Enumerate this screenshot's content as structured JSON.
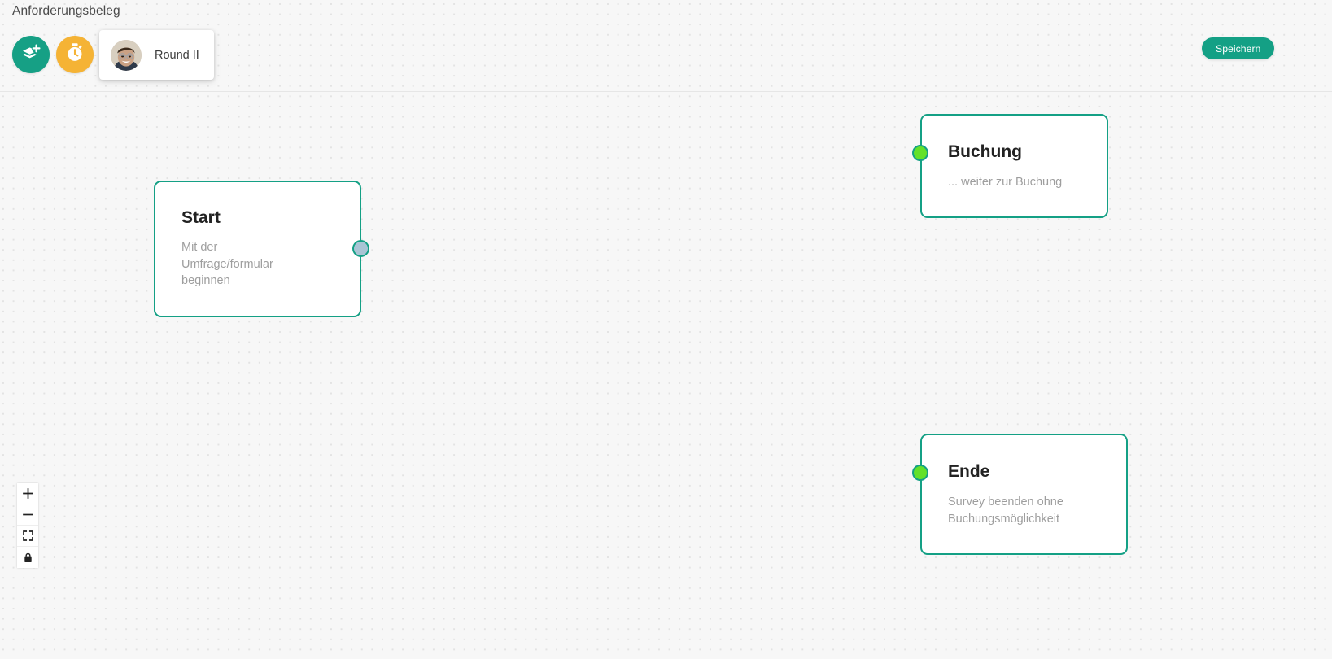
{
  "header": {
    "title": "Anforderungsbeleg",
    "add_layer_icon": "layers-plus-icon",
    "timer_icon": "stopwatch-icon",
    "add_layer_color": "#16a085",
    "timer_color": "#f5b335",
    "round_card": {
      "label": "Round II",
      "avatar": "user-avatar"
    },
    "save_label": "Speichern",
    "save_color": "#14a085"
  },
  "canvas": {
    "background_color": "#f7f7f7",
    "dot_color": "#e3e3e3",
    "node_border_color": "#14a085",
    "nodes": [
      {
        "id": "start",
        "title": "Start",
        "description": "Mit der Umfrage/formular beginnen",
        "handle": {
          "type": "source",
          "position": "right",
          "color": "#a9c4d4"
        }
      },
      {
        "id": "buchung",
        "title": "Buchung",
        "description": "... weiter zur Buchung",
        "handle": {
          "type": "target",
          "position": "left",
          "color": "#63e12a"
        }
      },
      {
        "id": "ende",
        "title": "Ende",
        "description": "Survey beenden ohne Buchungsmöglichkeit",
        "handle": {
          "type": "target",
          "position": "left",
          "color": "#63e12a"
        }
      }
    ]
  },
  "controls": [
    {
      "name": "zoom-in",
      "icon": "plus-icon",
      "label": "+"
    },
    {
      "name": "zoom-out",
      "icon": "minus-icon",
      "label": "−"
    },
    {
      "name": "fit-view",
      "icon": "fit-view-icon",
      "label": ""
    },
    {
      "name": "lock",
      "icon": "lock-icon",
      "label": ""
    }
  ]
}
